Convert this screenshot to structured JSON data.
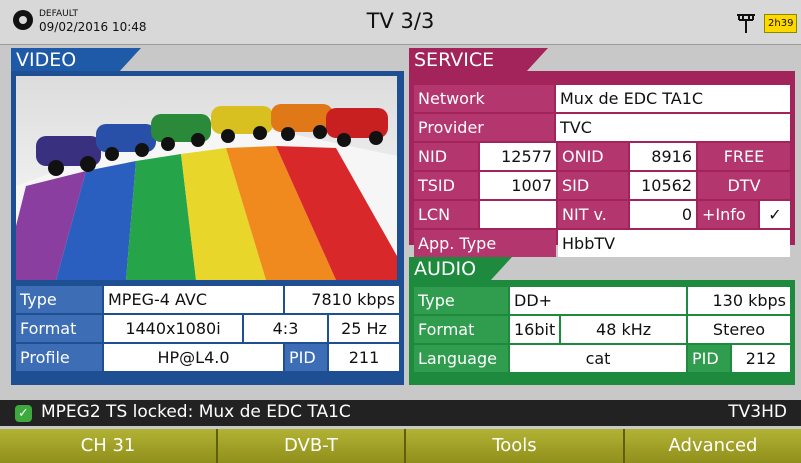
{
  "header": {
    "preset": "DEFAULT",
    "datetime": "09/02/2016 10:48",
    "title": "TV 3/3",
    "battery": "2h39",
    "antenna_icon": "antenna-icon",
    "logo_icon": "power-logo-icon"
  },
  "video": {
    "tab_label": "VIDEO",
    "thumbnail_icon": "video-thumbnail",
    "rows": {
      "type_label": "Type",
      "type_value": "MPEG-4 AVC",
      "bitrate": "7810 kbps",
      "format_label": "Format",
      "resolution": "1440x1080i",
      "aspect": "4:3",
      "framerate": "25 Hz",
      "profile_label": "Profile",
      "profile_value": "HP@L4.0",
      "pid_label": "PID",
      "pid_value": "211"
    }
  },
  "service": {
    "tab_label": "SERVICE",
    "network_label": "Network",
    "network_value": "Mux de EDC TA1C",
    "provider_label": "Provider",
    "provider_value": "TVC",
    "nid_label": "NID",
    "nid_value": "12577",
    "onid_label": "ONID",
    "onid_value": "8916",
    "scramble": "FREE",
    "tsid_label": "TSID",
    "tsid_value": "1007",
    "sid_label": "SID",
    "sid_value": "10562",
    "service_type": "DTV",
    "lcn_label": "LCN",
    "lcn_value": "",
    "nitv_label": "NIT v.",
    "nitv_value": "0",
    "info_label": "+Info",
    "info_check": "✓",
    "apptype_label": "App. Type",
    "apptype_value": "HbbTV"
  },
  "audio": {
    "tab_label": "AUDIO",
    "type_label": "Type",
    "type_value": "DD+",
    "bitrate": "130 kbps",
    "format_label": "Format",
    "bits": "16bit",
    "samplerate": "48 kHz",
    "channels": "Stereo",
    "language_label": "Language",
    "language_value": "cat",
    "pid_label": "PID",
    "pid_value": "212"
  },
  "status": {
    "lock_icon": "check-icon",
    "message": "MPEG2 TS locked: Mux de EDC TA1C",
    "service_name": "TV3HD"
  },
  "softkeys": [
    "CH 31",
    "DVB-T",
    "Tools",
    "Advanced"
  ],
  "colors": {
    "video_accent": "#1f5aa8",
    "service_accent": "#a3245a",
    "audio_accent": "#1e8a3e",
    "softkey": "#a4a42a",
    "battery": "#ffd800"
  }
}
